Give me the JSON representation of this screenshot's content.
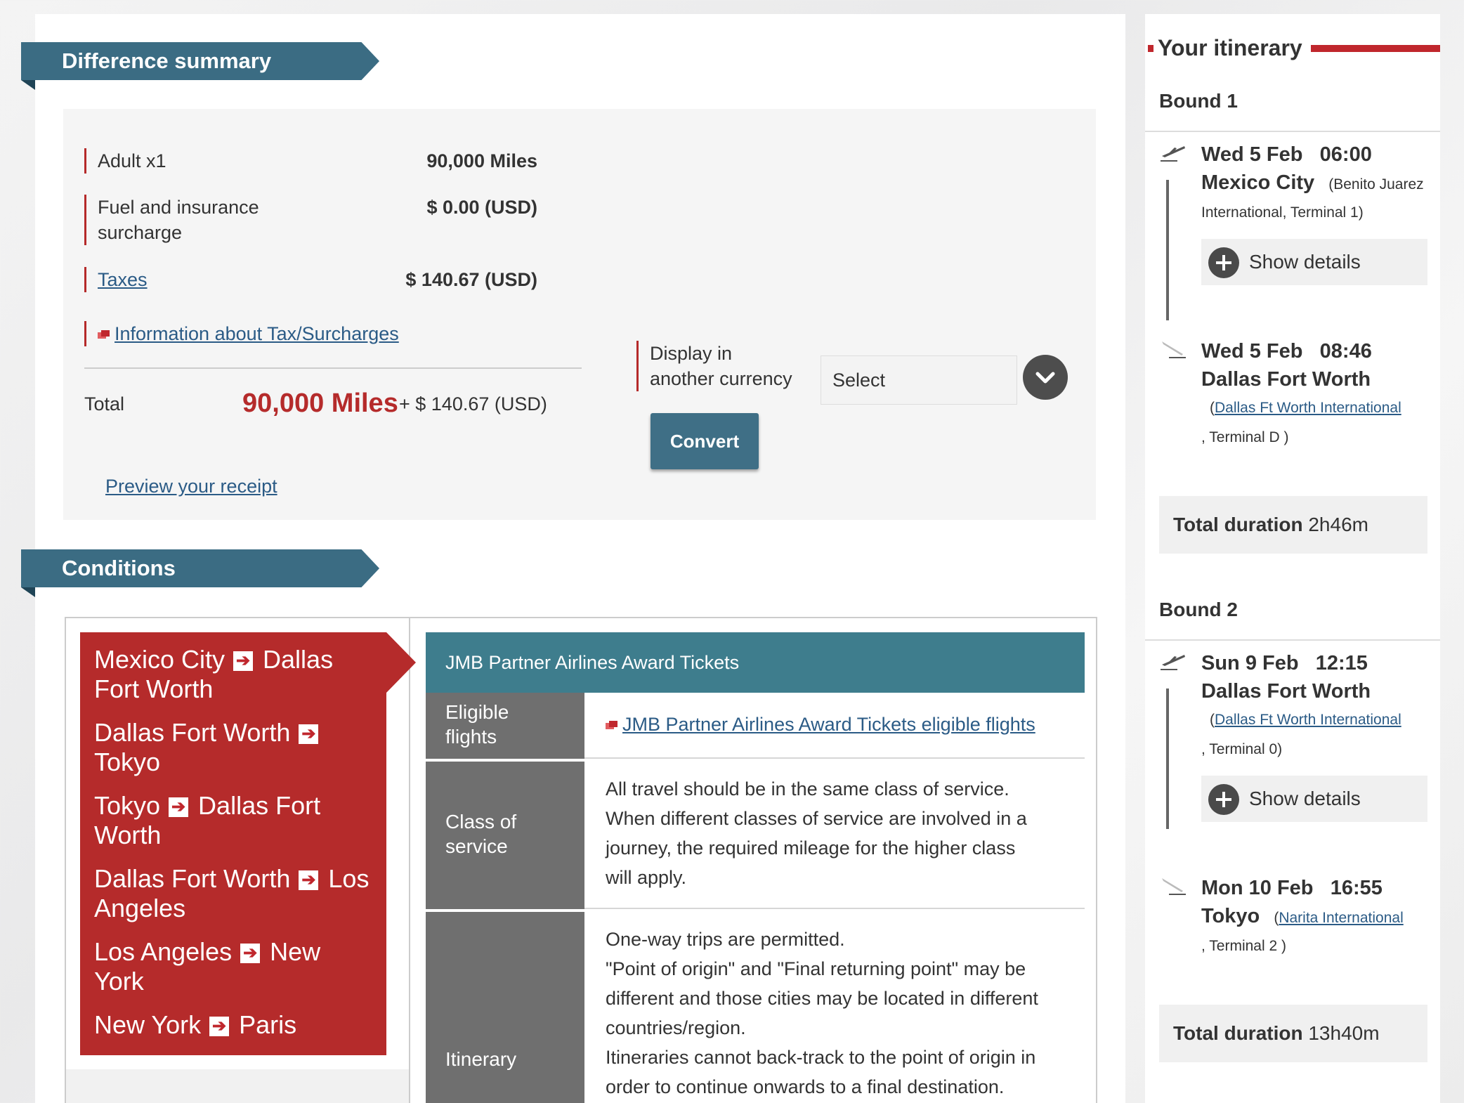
{
  "summary": {
    "banner": "Difference summary",
    "adult_label": "Adult x1",
    "adult_value": "90,000 Miles",
    "fuel_label_1": "Fuel and insurance",
    "fuel_label_2": "surcharge",
    "fuel_value": "$ 0.00 (USD)",
    "taxes_label": "Taxes",
    "taxes_value": "$ 140.67 (USD)",
    "info_link": "Information about Tax/Surcharges",
    "total_label": "Total",
    "total_miles": "90,000 Miles",
    "total_plus": "+ $ 140.67 (USD)",
    "preview_link": "Preview your receipt",
    "currency_label_1": "Display in",
    "currency_label_2": "another currency",
    "currency_select": "Select",
    "convert_button": "Convert"
  },
  "conditions": {
    "banner": "Conditions",
    "routes": [
      {
        "from": "Mexico City",
        "to": "Dallas Fort Worth"
      },
      {
        "from": "Dallas Fort Worth",
        "to": "Tokyo"
      },
      {
        "from": "Tokyo",
        "to": "Dallas Fort Worth"
      },
      {
        "from": "Dallas Fort Worth",
        "to": "Los Angeles"
      },
      {
        "from": "Los Angeles",
        "to": "New York"
      },
      {
        "from": "New York",
        "to": "Paris"
      }
    ],
    "arrow_glyph": "➔",
    "table_title": "JMB Partner Airlines Award Tickets",
    "eligible_label_1": "Eligible",
    "eligible_label_2": "flights",
    "eligible_link": "JMB Partner Airlines Award Tickets eligible flights",
    "class_label_1": "Class of",
    "class_label_2": "service",
    "class_text_1": "All travel should be in the same class of service.",
    "class_text_2": "When different classes of service are involved in a",
    "class_text_3": "journey, the required mileage for the higher class",
    "class_text_4": "will apply.",
    "itinerary_label": "Itinerary",
    "itin_text_1": "One-way trips are permitted.",
    "itin_text_2": "\"Point of origin\" and \"Final returning point\" may be",
    "itin_text_3": "different and those cities may be located in different",
    "itin_text_4": "countries/region.",
    "itin_text_5": "Itineraries cannot back-track to the point of origin in",
    "itin_text_6": "order to continue onwards to a final destination."
  },
  "itinerary": {
    "title": "Your itinerary",
    "bound1": {
      "title": "Bound 1",
      "dep_date": "Wed 5 Feb",
      "dep_time": "06:00",
      "dep_city": "Mexico City",
      "dep_airport_1": "(Benito Juarez",
      "dep_airport_2": "International, Terminal  1)",
      "show_details": "Show details",
      "arr_date": "Wed 5 Feb",
      "arr_time": "08:46",
      "arr_city": "Dallas Fort Worth",
      "arr_airport_open": "(",
      "arr_airport_link": "Dallas Ft Worth International",
      "arr_terminal": ", Terminal   D )",
      "total_label": "Total duration",
      "total_value": "2h46m"
    },
    "bound2": {
      "title": "Bound 2",
      "dep_date": "Sun 9 Feb",
      "dep_time": "12:15",
      "dep_city": "Dallas Fort Worth",
      "dep_airport_open": "(",
      "dep_airport_link": "Dallas Ft Worth International",
      "dep_terminal": ", Terminal  0)",
      "show_details": "Show details",
      "arr_date": "Mon 10 Feb",
      "arr_time": "16:55",
      "arr_city": "Tokyo",
      "arr_airport_open": "(",
      "arr_airport_link": "Narita International",
      "arr_terminal": ", Terminal   2 )",
      "total_label": "Total duration",
      "total_value": "13h40m"
    }
  },
  "colors": {
    "banner": "#3b6c83",
    "accent_red": "#b52b2b",
    "table_head": "#3e7d8d",
    "label_gray": "#6f6f6f"
  }
}
